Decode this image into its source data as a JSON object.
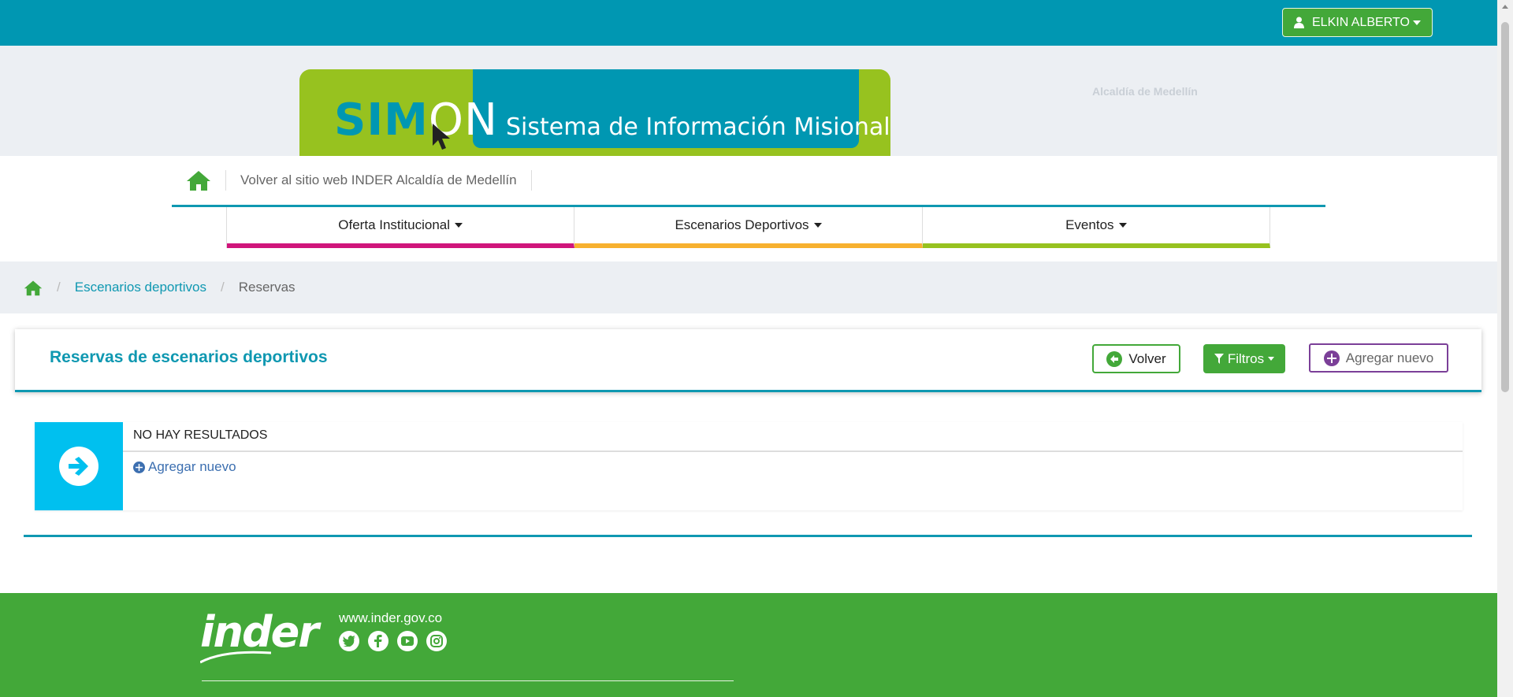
{
  "topbar": {
    "user_label": "ELKIN ALBERTO",
    "user_icon": "user-icon"
  },
  "banner": {
    "logo_sim": "SIM",
    "logo_on": "ON",
    "title": "Sistema de Información Misional",
    "ghost_text": "Alcaldía de Medellín"
  },
  "toplinks": {
    "home_icon": "home-icon",
    "back_link": "Volver al sitio web INDER Alcaldía de Medellín"
  },
  "menu": {
    "items": [
      {
        "label": "Oferta Institucional",
        "color": "#d0157b"
      },
      {
        "label": "Escenarios Deportivos",
        "color": "#f7b12f"
      },
      {
        "label": "Eventos",
        "color": "#97c21f"
      }
    ]
  },
  "breadcrumb": {
    "home_icon": "home-icon",
    "items": [
      "Escenarios deportivos",
      "Reservas"
    ]
  },
  "panel": {
    "title": "Reservas de escenarios deportivos",
    "volver_label": "Volver",
    "filtros_label": "Filtros",
    "agregar_label": "Agregar nuevo"
  },
  "result": {
    "title": "NO HAY RESULTADOS",
    "add_link": "Agregar nuevo"
  },
  "footer": {
    "logo_text": "inder",
    "url": "www.inder.gov.co",
    "social_icons": [
      "twitter-icon",
      "facebook-icon",
      "youtube-icon",
      "instagram-icon"
    ]
  },
  "colors": {
    "primary": "#0097b2",
    "green": "#43a839",
    "lime": "#97c21f",
    "magenta": "#d0157b",
    "orange": "#f7b12f",
    "purple": "#7b3f98",
    "info": "#00c0ef"
  }
}
